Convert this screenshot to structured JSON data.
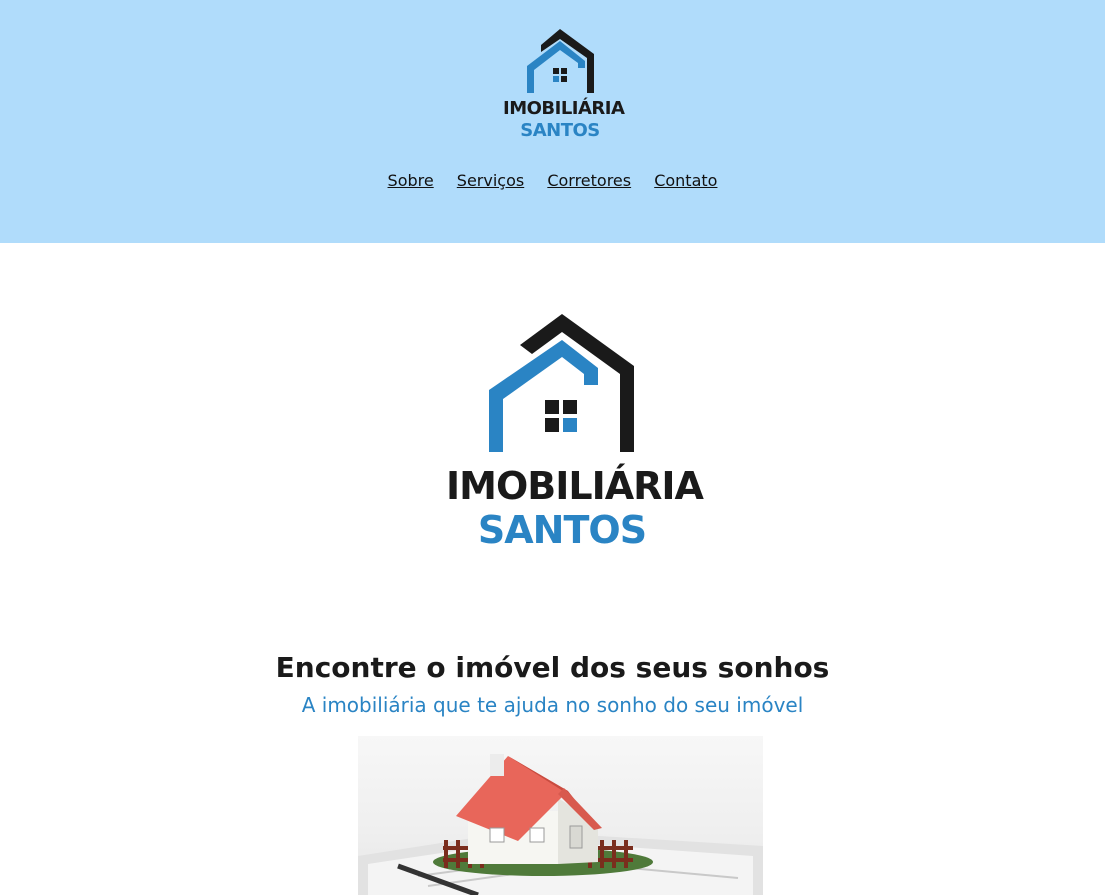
{
  "header": {
    "logo": {
      "line1": "IMOBILIÁRIA",
      "line2": "SANTOS"
    },
    "nav": [
      {
        "label": "Sobre"
      },
      {
        "label": "Serviços"
      },
      {
        "label": "Corretores"
      },
      {
        "label": "Contato"
      }
    ]
  },
  "hero": {
    "logo": {
      "line1": "IMOBILIÁRIA",
      "line2": "SANTOS"
    },
    "title": "Encontre o imóvel dos seus sonhos",
    "subtitle": "A imobiliária que te ajuda no sonho do seu imóvel"
  },
  "colors": {
    "header_bg": "#b0dcfb",
    "brand_blue": "#2a84c4",
    "brand_dark": "#1a1a1a",
    "roof_red": "#e8665a"
  },
  "icons": {
    "logo": "house-logo-icon",
    "photo": "model-house-photo"
  }
}
